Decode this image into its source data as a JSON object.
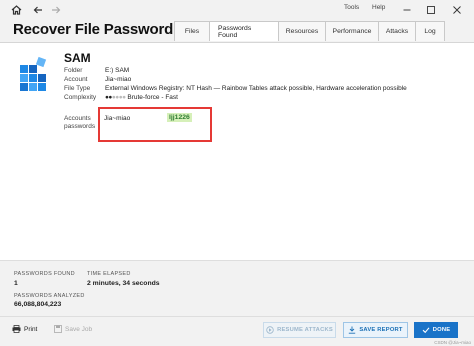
{
  "titlebar": {
    "menus": [
      "Tools",
      "Help"
    ]
  },
  "header": {
    "title": "Recover File Password",
    "tabs": [
      {
        "label": "Files"
      },
      {
        "label": "Passwords Found"
      },
      {
        "label": "Resources"
      },
      {
        "label": "Performance"
      },
      {
        "label": "Attacks"
      },
      {
        "label": "Log"
      }
    ],
    "active_tab": "Passwords Found"
  },
  "file": {
    "name": "SAM",
    "folder_label": "Folder",
    "folder_value": "E:) SAM",
    "account_label": "Account",
    "account_value": "Jia~miao",
    "filetype_label": "File Type",
    "filetype_value": "External Windows Registry: NT Hash — Rainbow Tables attack possible, Hardware acceleration possible",
    "complexity_label": "Complexity",
    "complexity_value": "Brute-force - Fast",
    "complexity_level": 0.333
  },
  "accounts": {
    "label_line1": "Accounts",
    "label_line2": "passwords",
    "user": "Jia~miao",
    "password": "ljj1226"
  },
  "stats": {
    "passwords_found_label": "PASSWORDS FOUND",
    "passwords_found_value": "1",
    "time_elapsed_label": "TIME ELAPSED",
    "time_elapsed_value": "2 minutes, 34 seconds",
    "passwords_analyzed_label": "PASSWORDS ANALYZED",
    "passwords_analyzed_value": "66,088,804,223"
  },
  "footer": {
    "print_label": "Print",
    "save_job_label": "Save Job",
    "resume_label": "RESUME ATTACKS",
    "save_report_label": "SAVE REPORT",
    "done_label": "DONE",
    "watermark": "CSDN @Jia~miao"
  },
  "colors": {
    "highlight_border": "#e53935",
    "password_text": "#2e7d32",
    "password_bg": "#d6f0b9",
    "primary": "#1a73c8"
  }
}
